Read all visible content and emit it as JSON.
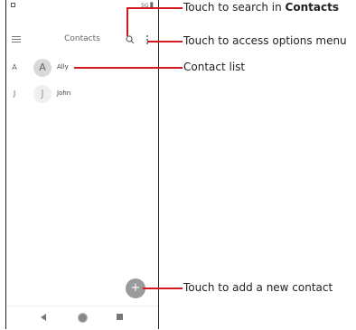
{
  "status_bar": {
    "right": "5G ▋"
  },
  "toolbar": {
    "title": "Contacts"
  },
  "contacts": [
    {
      "index": "A",
      "initial": "A",
      "name": "Ally",
      "avatar_bg": "#d9d9d9",
      "avatar_fg": "#666666"
    },
    {
      "index": "J",
      "initial": "J",
      "name": "John",
      "avatar_bg": "#efefef",
      "avatar_fg": "#999999"
    }
  ],
  "fab": {
    "label": "+"
  },
  "callouts": {
    "search_prefix": "Touch to search in ",
    "search_bold": "Contacts",
    "options": "Touch to access options menu",
    "list": "Contact list",
    "add": "Touch to add a new contact"
  },
  "colors": {
    "callout_line": "#d31920"
  }
}
